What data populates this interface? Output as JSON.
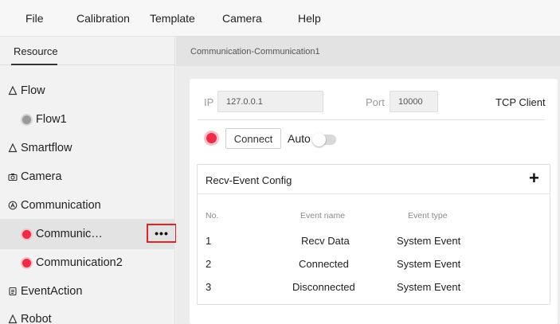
{
  "menu": [
    "File",
    "Calibration",
    "Template",
    "Camera",
    "Help"
  ],
  "sidebar": {
    "tab": "Resource",
    "items": [
      {
        "label": "Flow",
        "icon": "flow-icon"
      },
      {
        "label": "Flow1",
        "icon": "status-dot-gray"
      },
      {
        "label": "Smartflow",
        "icon": "smartflow-icon"
      },
      {
        "label": "Camera",
        "icon": "camera-icon"
      },
      {
        "label": "Communication",
        "icon": "communication-icon"
      },
      {
        "label": "Communic…",
        "icon": "status-dot-red"
      },
      {
        "label": "Communication2",
        "icon": "status-dot-red"
      },
      {
        "label": "EventAction",
        "icon": "event-action-icon"
      },
      {
        "label": "Robot",
        "icon": "robot-icon"
      }
    ],
    "more_label": "•••"
  },
  "panel": {
    "title": "Communication-Communication1",
    "ip_label": "IP",
    "ip_value": "127.0.0.1",
    "port_label": "Port",
    "port_value": "10000",
    "mode": "TCP Client",
    "connect_label": "Connect",
    "auto_label": "Auto",
    "auto_on": false
  },
  "recv": {
    "title": "Recv-Event Config",
    "add_label": "+",
    "columns": [
      "No.",
      "Event name",
      "Event type"
    ],
    "rows": [
      {
        "no": "1",
        "name": "Recv Data",
        "type": "System Event"
      },
      {
        "no": "2",
        "name": "Connected",
        "type": "System Event"
      },
      {
        "no": "3",
        "name": "Disconnected",
        "type": "System Event"
      }
    ]
  },
  "colors": {
    "accent_red": "#ef2b48",
    "highlight_border": "#e02424"
  }
}
